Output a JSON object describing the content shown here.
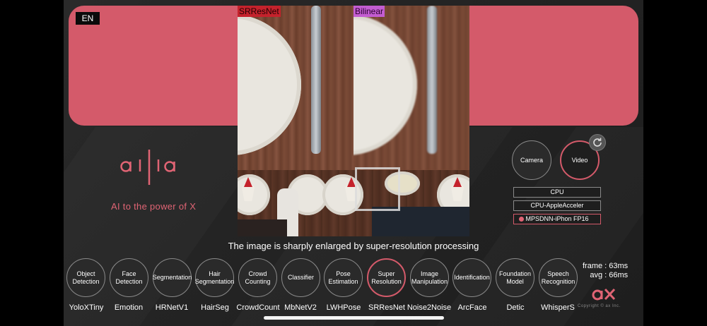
{
  "header": {
    "language": "EN"
  },
  "viewer": {
    "left_label": "SRResNet",
    "right_label": "Bilinear",
    "caption": "The image is sharply enlarged by super-resolution processing"
  },
  "brand": {
    "tagline": "AI to the power of X"
  },
  "source_buttons": [
    {
      "label": "Camera",
      "active": false
    },
    {
      "label": "Video",
      "active": true
    }
  ],
  "backends": [
    {
      "label": "CPU",
      "selected": false
    },
    {
      "label": "CPU-AppleAcceler",
      "selected": false
    },
    {
      "label": "MPSDNN-iPhon FP16",
      "selected": true
    }
  ],
  "tasks": [
    {
      "label": "Object\nDetection",
      "model": "YoloXTiny"
    },
    {
      "label": "Face\nDetection",
      "model": "Emotion"
    },
    {
      "label": "Segmentation",
      "model": "HRNetV1"
    },
    {
      "label": "Hair\nSegmentation",
      "model": "HairSeg"
    },
    {
      "label": "Crowd\nCounting",
      "model": "CrowdCount"
    },
    {
      "label": "Classifier",
      "model": "MbNetV2"
    },
    {
      "label": "Pose\nEstimation",
      "model": "LWHPose"
    },
    {
      "label": "Super\nResolution",
      "model": "SRResNet",
      "active": true
    },
    {
      "label": "Image\nManipulation",
      "model": "Noise2Noise"
    },
    {
      "label": "Identification",
      "model": "ArcFace"
    },
    {
      "label": "Foundation\nModel",
      "model": "Detic"
    },
    {
      "label": "Speech\nRecognition",
      "model": "WhisperS"
    }
  ],
  "stats": {
    "frame": "frame : 63ms",
    "avg": "avg : 66ms"
  },
  "footer": {
    "copyright": "Copyright © ax Inc."
  },
  "colors": {
    "accent": "#d45a6a",
    "background": "#252525"
  }
}
